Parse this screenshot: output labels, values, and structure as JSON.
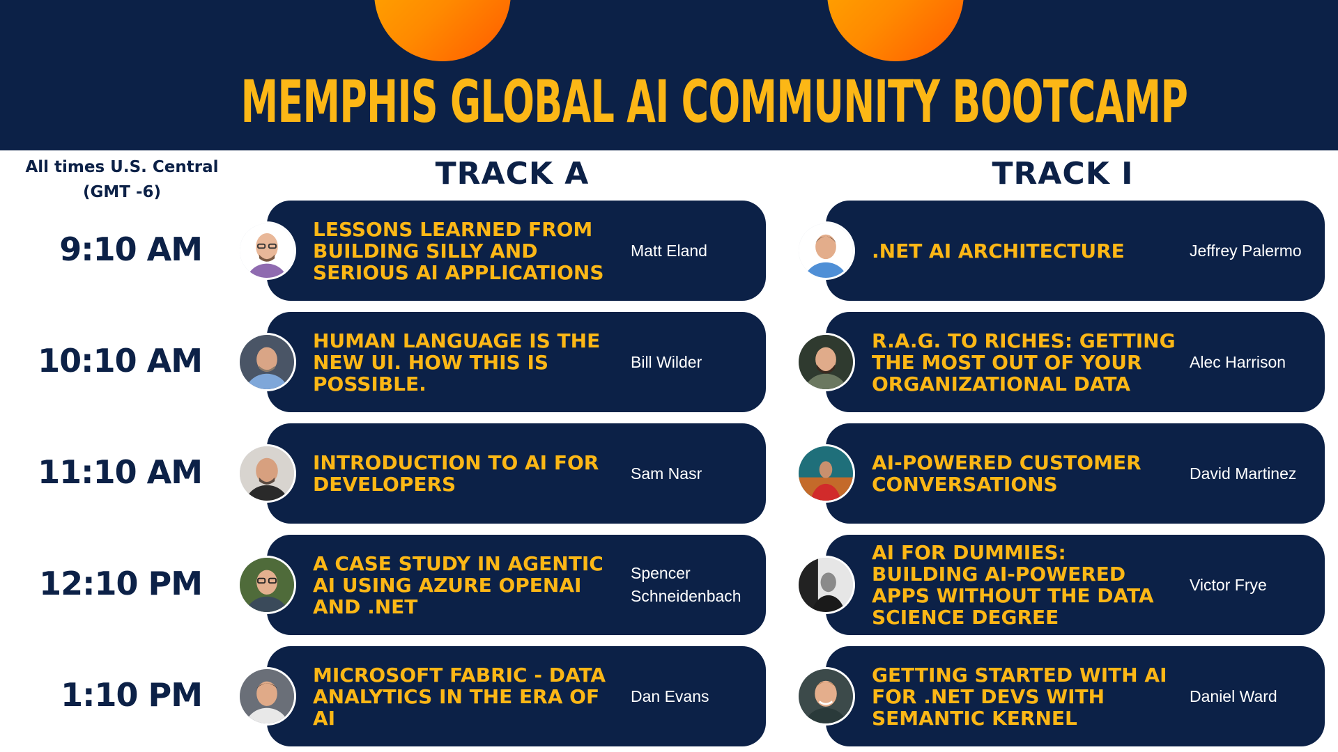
{
  "header": {
    "title": "MEMPHIS GLOBAL AI COMMUNITY BOOTCAMP"
  },
  "timezone_note": "All times U.S. Central (GMT -6)",
  "tracks": [
    {
      "label": "TRACK A"
    },
    {
      "label": "TRACK I"
    }
  ],
  "slots": [
    {
      "time": "9:10 AM",
      "a": {
        "session": "LESSONS LEARNED FROM BUILDING SILLY AND SERIOUS AI APPLICATIONS",
        "speaker": "Matt Eland"
      },
      "b": {
        "session": ".NET AI ARCHITECTURE",
        "speaker": "Jeffrey Palermo"
      }
    },
    {
      "time": "10:10 AM",
      "a": {
        "session": "HUMAN LANGUAGE IS THE NEW UI. HOW THIS IS POSSIBLE.",
        "speaker": "Bill Wilder"
      },
      "b": {
        "session": "R.A.G. TO RICHES: GETTING THE MOST OUT OF YOUR ORGANIZATIONAL DATA",
        "speaker": "Alec Harrison"
      }
    },
    {
      "time": "11:10 AM",
      "a": {
        "session": "INTRODUCTION TO AI FOR DEVELOPERS",
        "speaker": "Sam Nasr"
      },
      "b": {
        "session": "AI-POWERED CUSTOMER CONVERSATIONS",
        "speaker": "David Martinez"
      }
    },
    {
      "time": "12:10 PM",
      "a": {
        "session": "A CASE STUDY IN AGENTIC AI USING AZURE OPENAI AND .NET",
        "speaker": "Spencer Schneidenbach"
      },
      "b": {
        "session": "AI FOR DUMMIES: BUILDING AI-POWERED APPS WITHOUT THE DATA SCIENCE DEGREE",
        "speaker": "Victor Frye"
      }
    },
    {
      "time": "1:10 PM",
      "a": {
        "session": "MICROSOFT FABRIC - DATA ANALYTICS IN THE ERA OF AI",
        "speaker": "Dan Evans"
      },
      "b": {
        "session": "GETTING STARTED WITH AI FOR .NET DEVS WITH SEMANTIC KERNEL",
        "speaker": "Daniel Ward"
      }
    }
  ],
  "colors": {
    "navy": "#0c2147",
    "gold": "#fcb716",
    "sun_orange": "#ff8a00",
    "white": "#ffffff"
  }
}
